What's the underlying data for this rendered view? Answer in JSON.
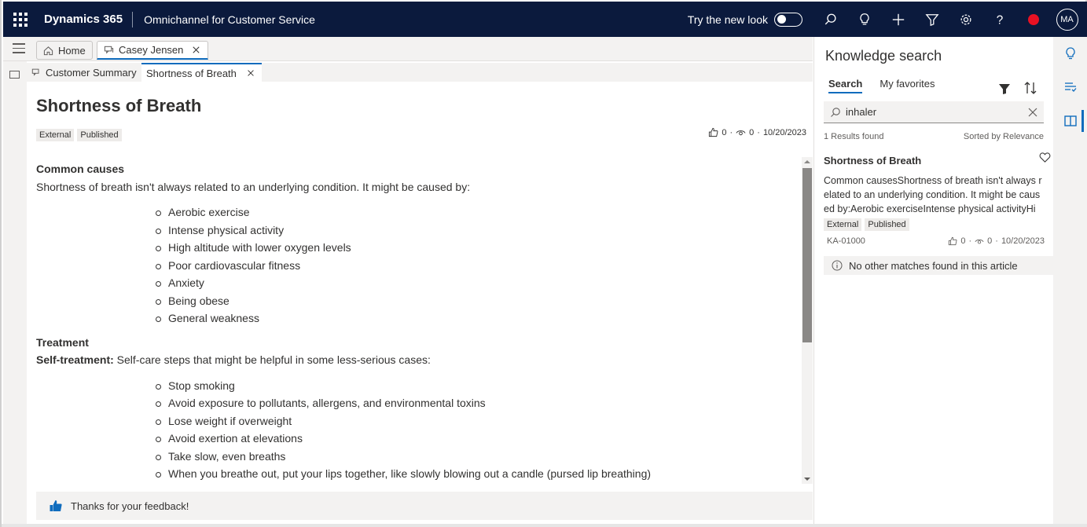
{
  "topbar": {
    "app_name": "Dynamics 365",
    "app_area": "Omnichannel for Customer Service",
    "new_look_label": "Try the new look",
    "avatar_initials": "MA",
    "icons": [
      "search-icon",
      "lightbulb-icon",
      "plus-icon",
      "filter-icon",
      "gear-icon",
      "help-icon",
      "presence-busy-icon"
    ]
  },
  "session_tabs": {
    "home_label": "Home",
    "casey_label": "Casey Jensen"
  },
  "inner_tabs": {
    "customer_summary": "Customer Summary",
    "shortness_of_breath": "Shortness of Breath"
  },
  "article": {
    "title": "Shortness of Breath",
    "tags": [
      "External",
      "Published"
    ],
    "likes": "0",
    "views": "0",
    "date": "10/20/2023",
    "sep": "·",
    "section1_heading": "Common causes",
    "section1_text": "Shortness of breath isn't always related to an underlying condition. It might be caused by:",
    "causes": [
      "Aerobic exercise",
      "Intense physical activity",
      "High altitude with lower oxygen levels",
      "Poor cardiovascular fitness",
      "Anxiety",
      "Being obese",
      "General weakness"
    ],
    "section2_heading": "Treatment",
    "self_treatment_label": "Self-treatment:",
    "self_treatment_text": " Self-care steps that might be helpful in some less-serious cases:",
    "steps": [
      "Stop smoking",
      "Avoid exposure to pollutants, allergens, and environmental toxins",
      "Lose weight if overweight",
      "Avoid exertion at elevations",
      "Take slow, even breaths",
      "When you breathe out, put your lips together, like slowly blowing out a candle (pursed lip breathing)"
    ],
    "feedback_text": "Thanks for your feedback!"
  },
  "knowledge": {
    "title": "Knowledge search",
    "tab_search": "Search",
    "tab_favorites": "My favorites",
    "search_value": "inhaler",
    "results_count": "1 Results found",
    "sorted_by": "Sorted by Relevance",
    "result": {
      "title": "Shortness of Breath",
      "snippet": "Common causesShortness of breath isn't always related to an underlying condition. It might be  caused by:Aerobic exerciseIntense physical activityHig…",
      "tags": [
        "External",
        "Published"
      ],
      "id": "KA-01000",
      "likes": "0",
      "views": "0",
      "date": "10/20/2023",
      "sep": "·"
    },
    "no_matches": "No other matches found in this article"
  },
  "colors": {
    "nav_bg": "#0b1a3d",
    "accent": "#0f6cbd",
    "presence": "#e81123"
  }
}
